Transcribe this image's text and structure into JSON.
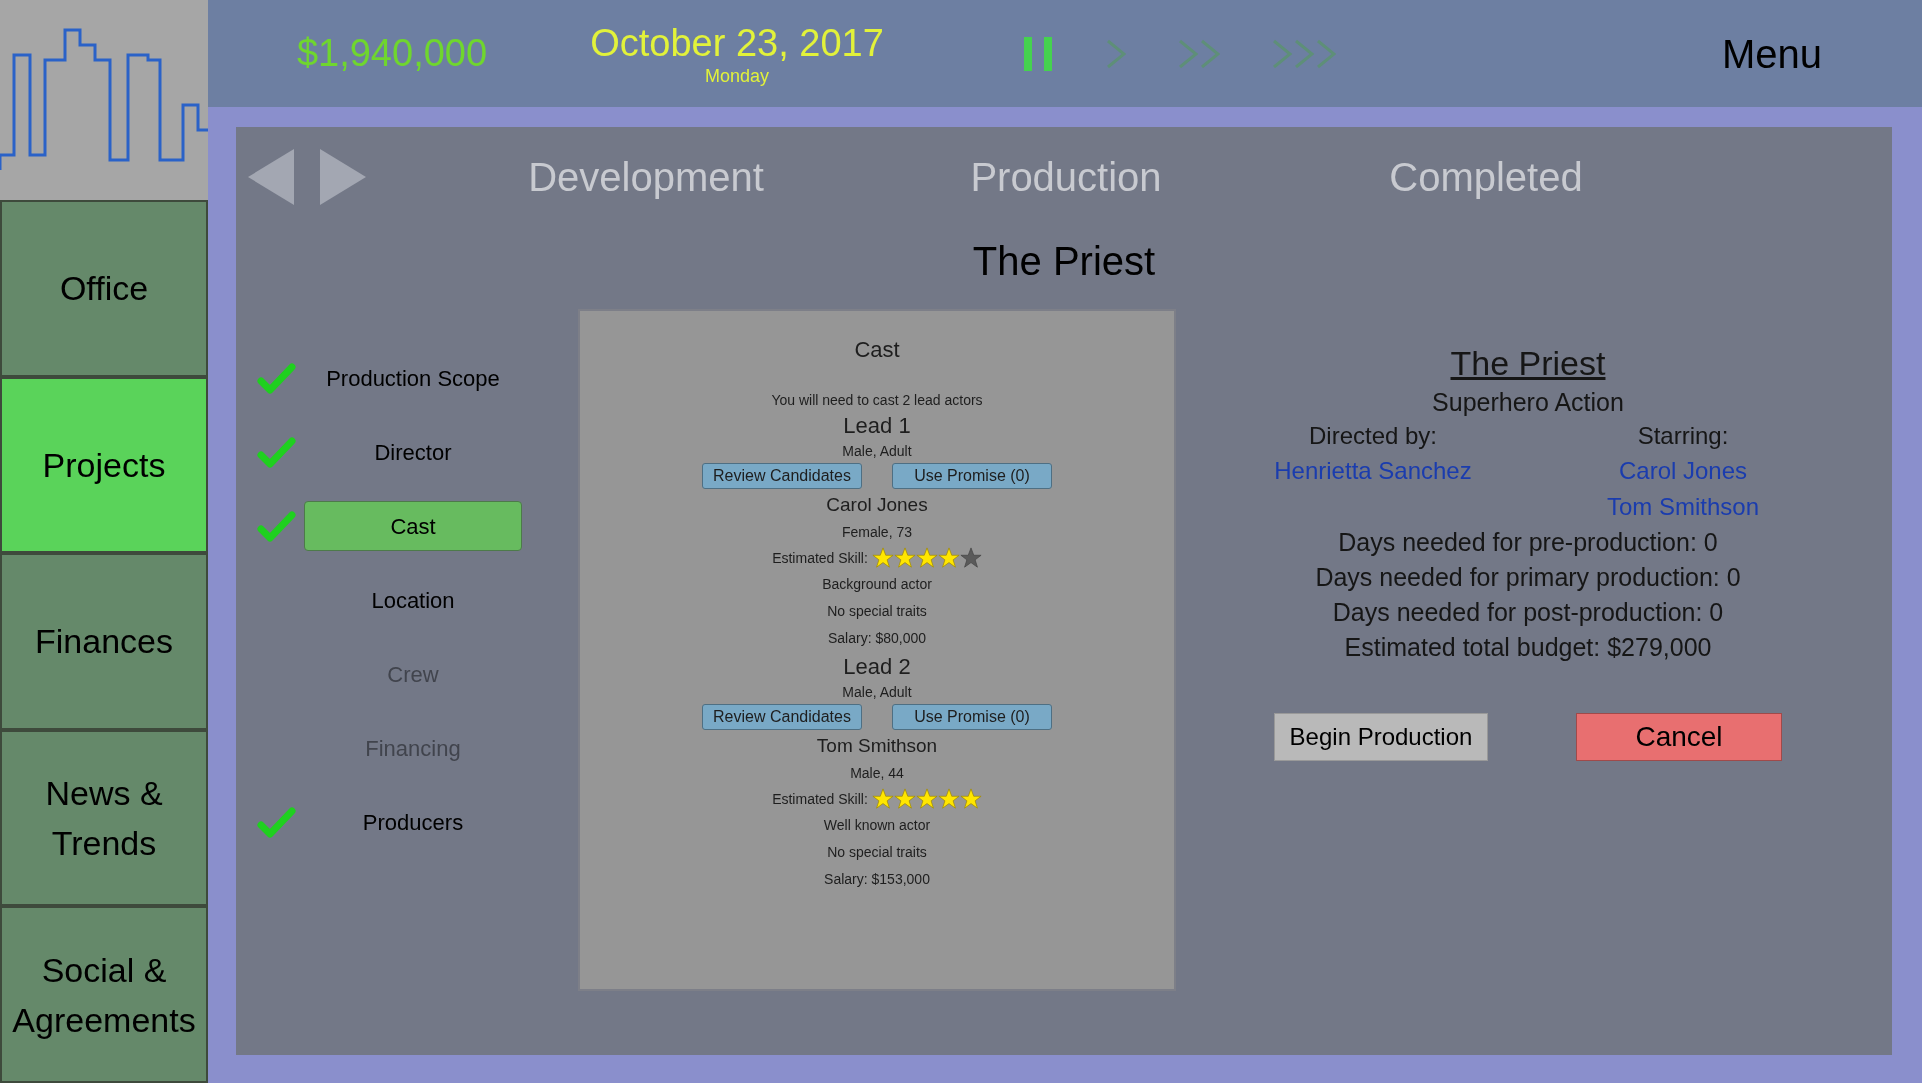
{
  "sidebar": {
    "items": [
      {
        "label": "Office",
        "selected": false
      },
      {
        "label": "Projects",
        "selected": true
      },
      {
        "label": "Finances",
        "selected": false
      },
      {
        "label": "News &\nTrends",
        "selected": false
      },
      {
        "label": "Social &\nAgreements",
        "selected": false
      }
    ]
  },
  "top_bar": {
    "money": "$1,940,000",
    "date": "October 23, 2017",
    "weekday": "Monday",
    "speed_controls": [
      {
        "kind": "pause",
        "selected": true
      },
      {
        "kind": "play",
        "selected": false
      },
      {
        "kind": "fast",
        "selected": false
      },
      {
        "kind": "fastest",
        "selected": false
      }
    ],
    "menu": "Menu"
  },
  "tabs": [
    {
      "label": "Development"
    },
    {
      "label": "Production"
    },
    {
      "label": "Completed"
    }
  ],
  "project_title": "The Priest",
  "steps": [
    {
      "label": "Production Scope",
      "checked": true,
      "selected": false,
      "disabled": false
    },
    {
      "label": "Director",
      "checked": true,
      "selected": false,
      "disabled": false
    },
    {
      "label": "Cast",
      "checked": true,
      "selected": true,
      "disabled": false
    },
    {
      "label": "Location",
      "checked": false,
      "selected": false,
      "disabled": false
    },
    {
      "label": "Crew",
      "checked": false,
      "selected": false,
      "disabled": true
    },
    {
      "label": "Financing",
      "checked": false,
      "selected": false,
      "disabled": true
    },
    {
      "label": "Producers",
      "checked": true,
      "selected": false,
      "disabled": false
    }
  ],
  "cast_panel": {
    "title": "Cast",
    "note": "You will need to cast 2 lead actors",
    "leads": [
      {
        "role": "Lead 1",
        "requirement": "Male, Adult",
        "review_button": "Review Candidates",
        "promise_button": "Use Promise (0)",
        "actor": "Carol Jones",
        "details": "Female, 73",
        "skill_label": "Estimated Skill:",
        "stars": 4,
        "fame": "Background actor",
        "traits": "No special traits",
        "salary": "Salary: $80,000"
      },
      {
        "role": "Lead 2",
        "requirement": "Male, Adult",
        "review_button": "Review Candidates",
        "promise_button": "Use Promise (0)",
        "actor": "Tom Smithson",
        "details": "Male, 44",
        "skill_label": "Estimated Skill:",
        "stars": 5,
        "fame": "Well known actor",
        "traits": "No special traits",
        "salary": "Salary: $153,000"
      }
    ]
  },
  "summary": {
    "title": "The Priest",
    "genre": "Superhero Action",
    "directed_label": "Directed by:",
    "directors": [
      "Henrietta Sanchez"
    ],
    "starring_label": "Starring:",
    "stars_list": [
      "Carol Jones",
      "Tom Smithson"
    ],
    "facts": [
      "Days needed for pre-production: 0",
      "Days needed for primary production: 0",
      "Days needed for post-production: 0",
      "Estimated total budget: $279,000"
    ],
    "begin_button": "Begin Production",
    "cancel_button": "Cancel"
  }
}
